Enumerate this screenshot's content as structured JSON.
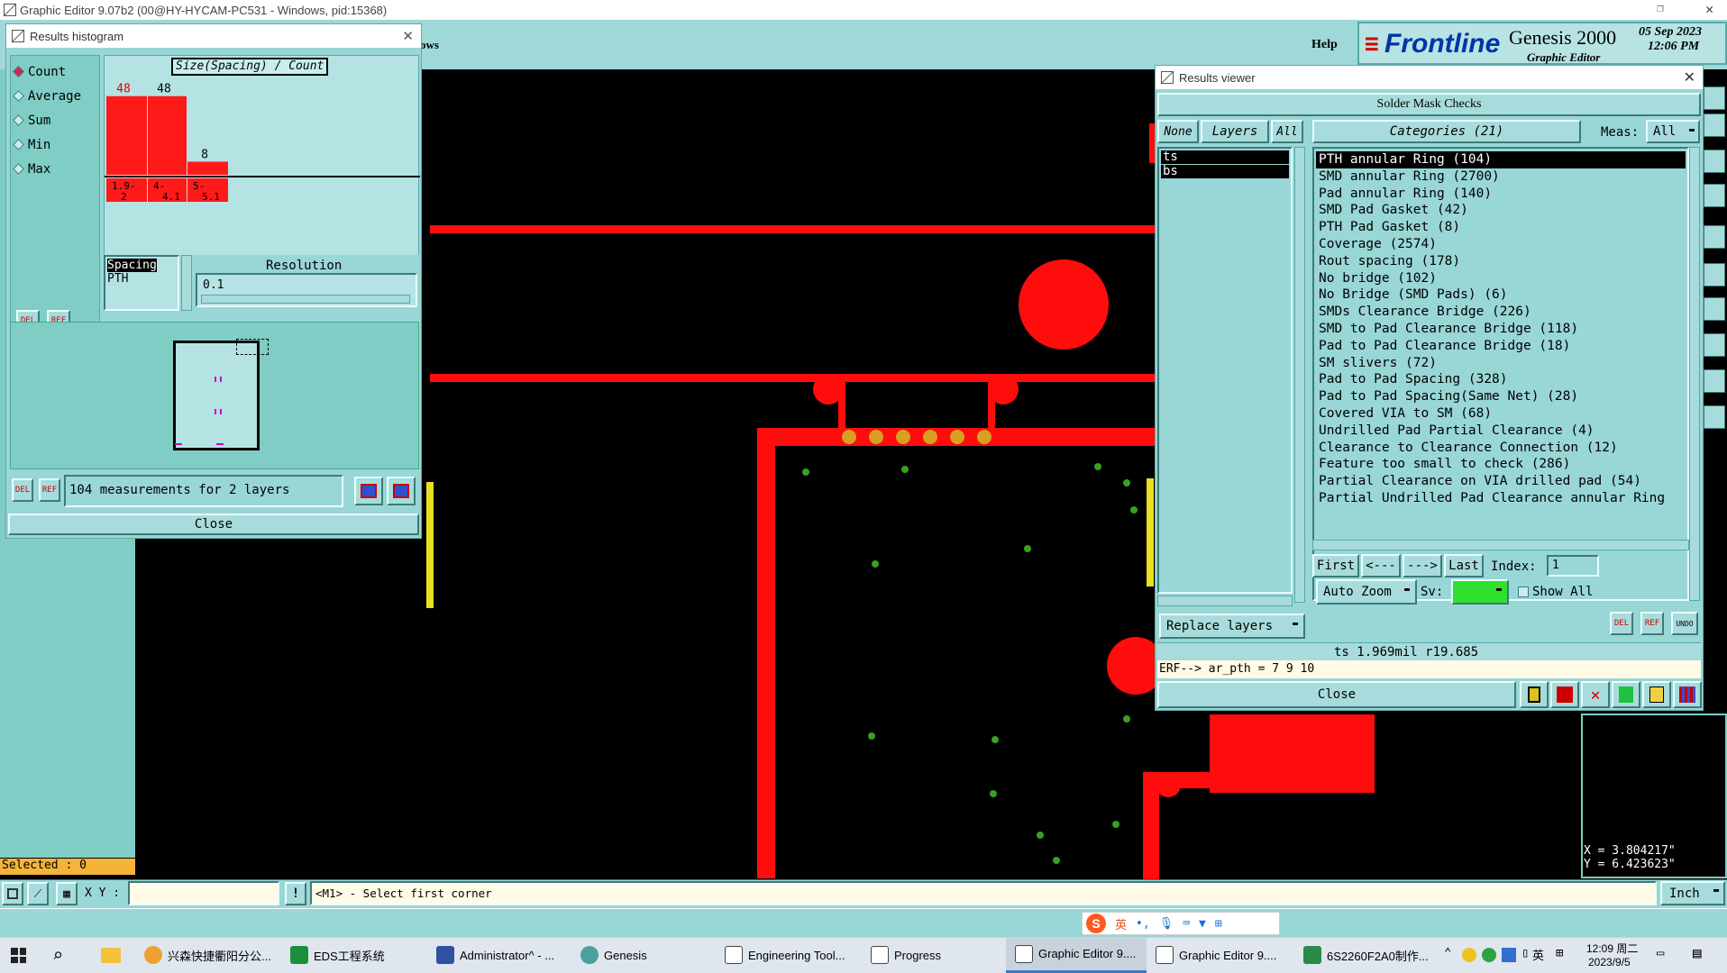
{
  "app": {
    "title": "Graphic Editor 9.07b2 (00@HY-HYCAM-PC531 - Windows, pid:15368)",
    "menu_tail": "ows",
    "help": "Help",
    "brand": "Frontline",
    "product": "Genesis 2000",
    "subtitle": "Graphic Editor",
    "date": "05 Sep 2023",
    "time": "12:06 PM"
  },
  "histogram": {
    "title": "Results histogram",
    "modes": [
      "Count",
      "Average",
      "Sum",
      "Min",
      "Max"
    ],
    "selected_mode": "Count",
    "header": "Size(Spacing) / Count",
    "del": "DEL",
    "ref": "REF",
    "spacing_label": "Spacing",
    "pth_label": "PTH",
    "resolution_label": "Resolution",
    "resolution_value": "0.1",
    "measurements": "104 measurements for 2 layers",
    "close": "Close"
  },
  "chart_data": {
    "type": "bar",
    "title": "Size(Spacing) / Count",
    "categories": [
      "1.9-2",
      "4-4.1",
      "5-5.1"
    ],
    "category_labels": [
      [
        "1.9-",
        "2"
      ],
      [
        "4-",
        "4.1"
      ],
      [
        "5-",
        "5.1"
      ]
    ],
    "values": [
      48,
      48,
      8
    ],
    "ylim": [
      0,
      55
    ],
    "colors": {
      "bar": "#ff1a1a",
      "value_first": "#e00000",
      "value_other": "#000000"
    }
  },
  "results": {
    "title": "Results viewer",
    "header": "Solder Mask Checks",
    "none": "None",
    "layers_label": "Layers",
    "all": "All",
    "layers": [
      "ts",
      "bs"
    ],
    "categories_label": "Categories (21)",
    "meas_label": "Meas:",
    "meas_value": "All",
    "categories": [
      "PTH annular Ring (104)",
      "SMD annular Ring (2700)",
      "Pad annular Ring (140)",
      "SMD Pad Gasket (42)",
      "PTH Pad Gasket (8)",
      "Coverage (2574)",
      "Rout spacing (178)",
      "No bridge (102)",
      "No Bridge (SMD Pads) (6)",
      "SMDs Clearance Bridge (226)",
      "SMD to Pad Clearance Bridge (118)",
      "Pad to Pad Clearance Bridge (18)",
      "SM slivers (72)",
      "Pad to Pad Spacing (328)",
      "Pad to Pad Spacing(Same Net) (28)",
      "Covered VIA to SM (68)",
      "Undrilled Pad Partial Clearance (4)",
      "Clearance to Clearance Connection (12)",
      "Feature too small to check (286)",
      "Partial Clearance on VIA drilled pad (54)",
      "Partial Undrilled Pad Clearance annular Ring"
    ],
    "first": "First",
    "prev": "<---",
    "next": "--->",
    "last": "Last",
    "index_label": "Index:",
    "index_value": "1",
    "auto_zoom": "Auto Zoom",
    "sv_label": "Sv:",
    "show_all": "Show All",
    "replace_layers": "Replace layers",
    "del": "DEL",
    "ref": "REF",
    "undo": "UNDO",
    "info": "ts 1.969mil  r19.685",
    "erf": "ERF--> ar_pth = 7 9 10",
    "close": "Close"
  },
  "status": {
    "selected": "Selected : 0",
    "xy_label": "X Y :",
    "prompt": "<M1> - Select first corner",
    "units": "Inch",
    "coord_x": "X = 3.804217\"",
    "coord_y": "Y = 6.423623\""
  },
  "ime": {
    "lang": "英"
  },
  "taskbar": {
    "items": [
      "兴森快捷衢阳分公...",
      "EDS工程系统",
      "Administrator^ - ...",
      "Genesis",
      "Engineering Tool...",
      "Progress",
      "Graphic Editor 9....",
      "Graphic Editor 9....",
      "6S2260F2A0制作..."
    ],
    "tray_lang": "英",
    "clock_time": "12:09 周二",
    "clock_date": "2023/9/5"
  }
}
